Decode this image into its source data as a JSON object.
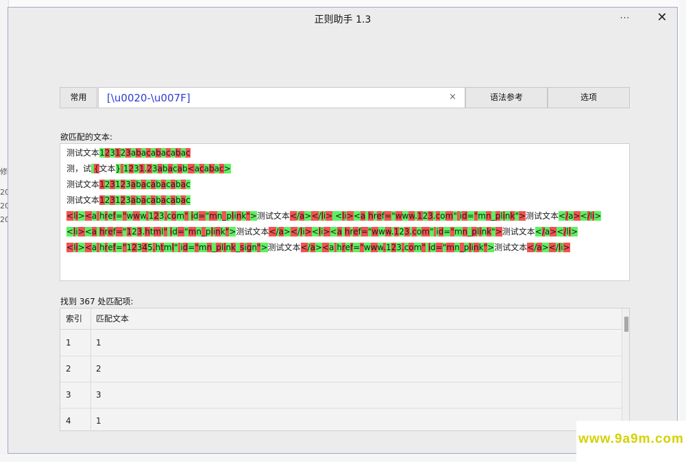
{
  "window": {
    "title": "正则助手 1.3",
    "more_label": "···",
    "close_label": "✕"
  },
  "toolbar": {
    "common_label": "常用",
    "regex_value": "[\\u0020-\\u007F]",
    "clear_label": "×",
    "syntax_label": "语法参考",
    "options_label": "选项"
  },
  "text_section": {
    "label": "欲匹配的文本:",
    "lines": [
      "测试文本123123abacabacabac",
      "测，试 {文本} 1231.23abacab<acabac>",
      "测试文本123123abacabacabac",
      "测试文本123123abacabacabac",
      "<li><a href=\"www.123.com\" id=\"mn_plink\">测试文本</a></li>  <li><a href=\"www.123.com\" id=\"mn_plink\">测试文本</a></li>",
      " <li><a href=\"123.html\" id=\"mn_plink\">测试文本</a></li><li><a href=\"www.123.com\" id=\"mn_plink\">测试文本</a></li>",
      "  <li><a href=\"12345.html\" id=\"mn_plink_sign\">测试文本</a><a href=\"www.123.com\" id=\"mn_plink\">测试文本</a></li>"
    ]
  },
  "results": {
    "label": "找到 367 处匹配项:",
    "columns": [
      "索引",
      "匹配文本"
    ],
    "rows": [
      {
        "index": "1",
        "text": "1"
      },
      {
        "index": "2",
        "text": "2"
      },
      {
        "index": "3",
        "text": "3"
      },
      {
        "index": "4",
        "text": "1"
      }
    ]
  },
  "background": {
    "left_items": [
      "修",
      "20",
      "20",
      "20"
    ]
  },
  "watermark": "www.9a9m.com",
  "colors": {
    "match_even": "#5ef060",
    "match_odd": "#f25252",
    "regex_text": "#2a3bd8",
    "watermark": "#d4d200"
  }
}
